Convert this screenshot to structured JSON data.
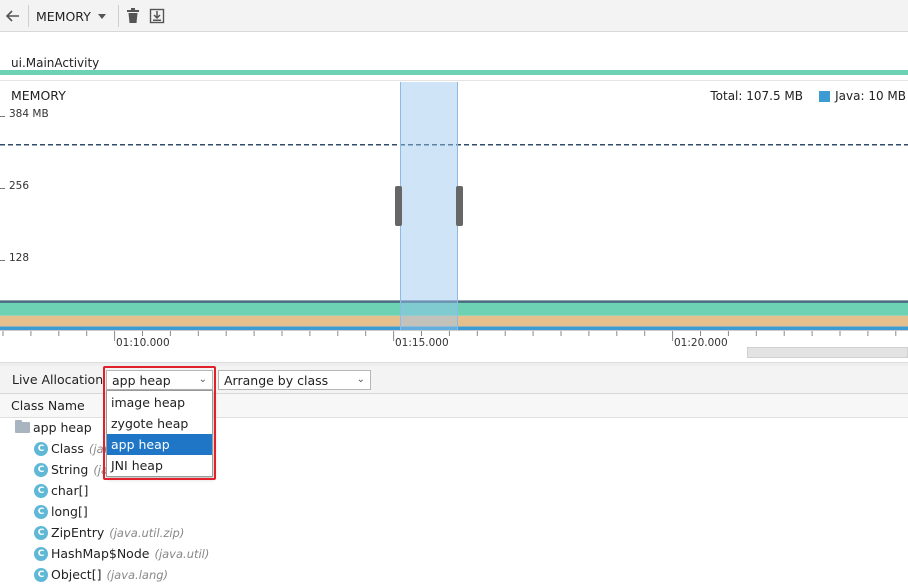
{
  "toolbar": {
    "back_icon": "arrow-left-icon",
    "monitor_label": "MEMORY",
    "delete_icon": "trash-icon",
    "save_icon": "save-download-icon"
  },
  "activity": {
    "label": "ui.MainActivity",
    "bar_color": "#6dd2b4"
  },
  "memory": {
    "title": "MEMORY",
    "total": "Total: 107.5 MB",
    "legend_java": "Java: 10 MB",
    "java_color": "#3b9bd2",
    "y_ticks": [
      "384 MB",
      "256",
      "128"
    ]
  },
  "chart_data": {
    "type": "area",
    "title": "MEMORY",
    "y_ticks": [
      128,
      256,
      384
    ],
    "ylim": [
      0,
      384
    ],
    "x_ticks": [
      "01:10.000",
      "01:15.000",
      "01:20.000"
    ],
    "series": [
      {
        "name": "Java",
        "values": [
          10,
          10,
          10,
          10
        ],
        "color": "#3b9bd2"
      },
      {
        "values": [
          19,
          19,
          19,
          19
        ],
        "color": "#e5c08e"
      },
      {
        "values": [
          25,
          25,
          25,
          25
        ],
        "color": "#6dd2b4"
      }
    ],
    "dashed_limit": 333,
    "total_mb": 107.5
  },
  "time_axis": {
    "labels": [
      "01:10.000",
      "01:15.000",
      "01:20.000"
    ]
  },
  "allocation": {
    "label": "Live Allocation",
    "heap_selected": "app heap",
    "arrange_selected": "Arrange by class",
    "heap_options": [
      "image heap",
      "zygote heap",
      "app heap",
      "JNI heap"
    ]
  },
  "tree": {
    "column_header": "Class Name",
    "root": "app heap",
    "rows": [
      {
        "name": "Class",
        "pkg": "(java.lang)"
      },
      {
        "name": "String",
        "pkg": "(java.lang)"
      },
      {
        "name": "char[]",
        "pkg": ""
      },
      {
        "name": "long[]",
        "pkg": ""
      },
      {
        "name": "ZipEntry",
        "pkg": "(java.util.zip)"
      },
      {
        "name": "HashMap$Node",
        "pkg": "(java.util)"
      },
      {
        "name": "Object[]",
        "pkg": "(java.lang)"
      }
    ]
  }
}
